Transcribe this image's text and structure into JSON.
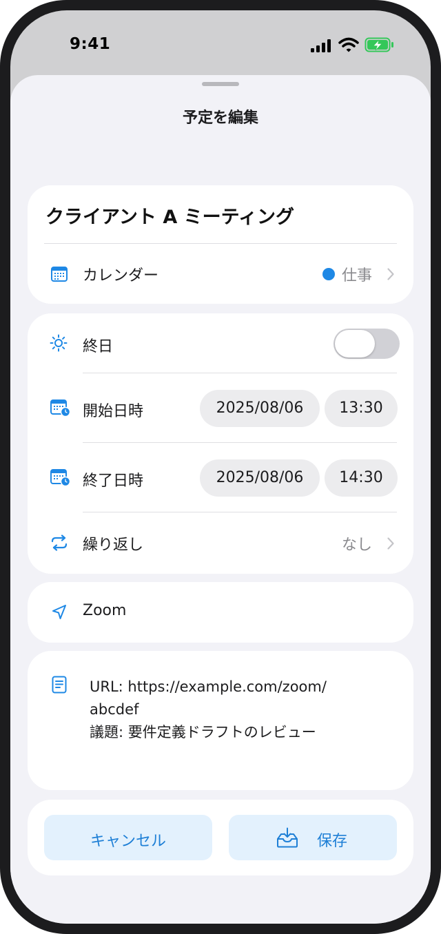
{
  "status_bar": {
    "time": "9:41",
    "icons": [
      "cellular-signal-icon",
      "wifi-icon",
      "battery-charging-icon"
    ]
  },
  "sheet": {
    "title": "予定を編集"
  },
  "event": {
    "title": "クライアント A ミーティング",
    "calendar_label": "カレンダー",
    "calendar_value": "仕事",
    "calendar_color": "#1e88e5"
  },
  "schedule": {
    "all_day_label": "終日",
    "all_day_on": false,
    "start_label": "開始日時",
    "start_date": "2025/08/06",
    "start_time": "13:30",
    "end_label": "終了日時",
    "end_date": "2025/08/06",
    "end_time": "14:30",
    "repeat_label": "繰り返し",
    "repeat_value": "なし"
  },
  "location": {
    "value": "Zoom"
  },
  "notes": {
    "lines": [
      "URL: https://example.com/zoom/",
      "abcdef",
      "議題: 要件定義ドラフトのレビュー"
    ]
  },
  "actions": {
    "cancel_label": "キャンセル",
    "save_label": "保存"
  },
  "colors": {
    "accent": "#1e88e5",
    "button_bg": "#e3f1fd",
    "sheet_bg": "#f2f2f7"
  }
}
